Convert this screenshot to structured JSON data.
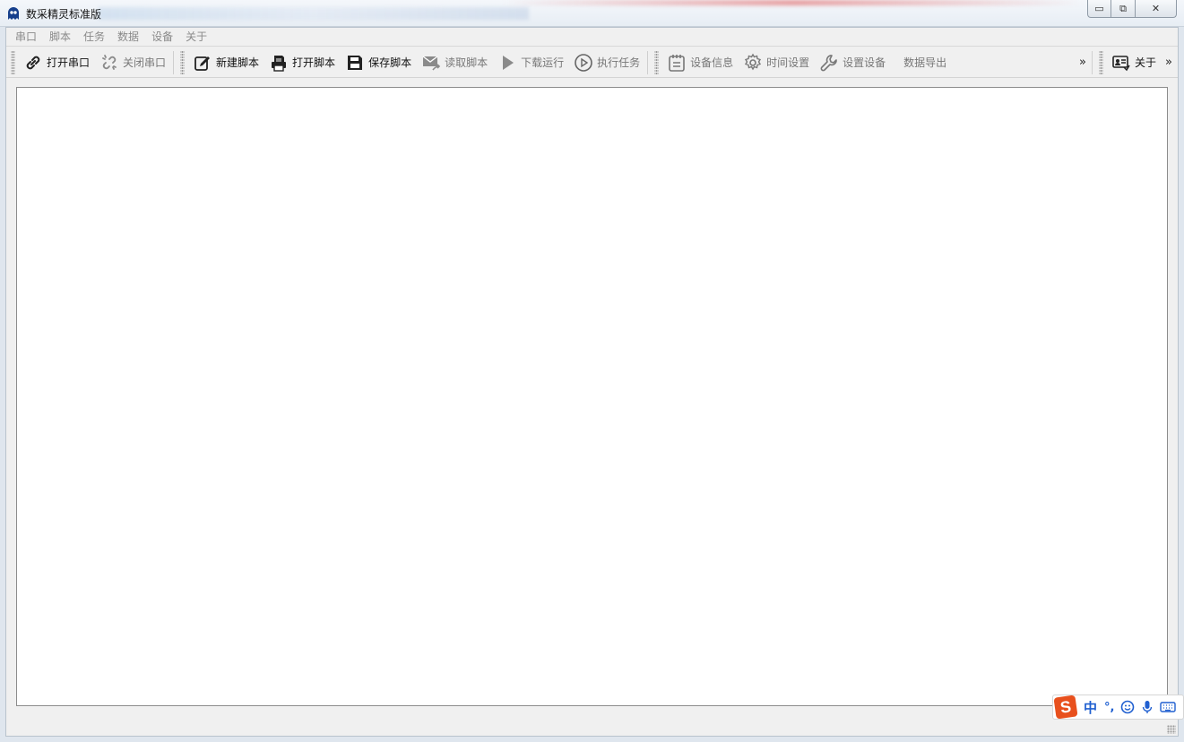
{
  "window": {
    "title": "数采精灵标准版",
    "controls": {
      "minimize": "▭",
      "maximize": "⧉",
      "close": "✕"
    }
  },
  "menu": [
    "串口",
    "脚本",
    "任务",
    "数据",
    "设备",
    "关于"
  ],
  "toolbar": {
    "open_port": "打开串口",
    "close_port": "关闭串口",
    "new_script": "新建脚本",
    "open_script": "打开脚本",
    "save_script": "保存脚本",
    "read_script": "读取脚本",
    "download_run": "下载运行",
    "run_task": "执行任务",
    "device_info": "设备信息",
    "time_settings": "时间设置",
    "device_settings": "设置设备",
    "data_export": "数据导出",
    "overflow": "»",
    "about": "关于",
    "overflow2": "»"
  },
  "editor": {
    "content": ""
  },
  "ime": {
    "logo": "S",
    "mode": "中",
    "punct": "°,"
  },
  "colors": {
    "ime_brand": "#e8501d",
    "ime_accent": "#1f5fd0"
  }
}
